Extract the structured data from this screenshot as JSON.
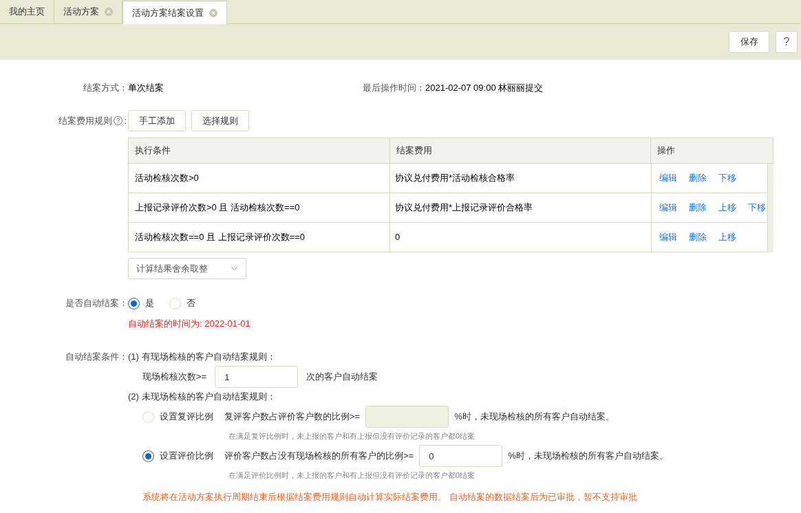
{
  "tabs": [
    {
      "label": "我的主页",
      "selected": false,
      "closable": false
    },
    {
      "label": "活动方案",
      "selected": false,
      "closable": true
    },
    {
      "label": "活动方案结案设置",
      "selected": true,
      "closable": true
    }
  ],
  "toolbar": {
    "save": "保存",
    "help": "?"
  },
  "info": {
    "close_mode_label": "结案方式：",
    "close_mode": "单次结案",
    "last_op_label": "最后操作时间：",
    "last_op": "2021-02-07 09:00 林丽丽提交"
  },
  "fee_rules": {
    "label": "结案费用规则",
    "help_mark": "?",
    "colon": ":",
    "buttons": [
      "手工添加",
      "选择规则"
    ],
    "columns": [
      "执行条件",
      "结案费用",
      "操作"
    ],
    "rows": [
      {
        "condition": "活动检核次数>0",
        "fee": "协议兑付费用*活动检核合格率",
        "actions": [
          "编辑",
          "删除",
          "下移"
        ]
      },
      {
        "condition": "上报记录评价次数>0 且 活动检核次数==0",
        "fee": "协议兑付费用*上报记录评价合格率",
        "actions": [
          "编辑",
          "删除",
          "上移",
          "下移"
        ]
      },
      {
        "condition": "活动检核次数==0 且 上报记录评价次数==0",
        "fee": "0",
        "actions": [
          "编辑",
          "删除",
          "上移"
        ]
      }
    ],
    "rounding": "计算结果舍余取整"
  },
  "auto_close": {
    "label": "是否自动结案：",
    "options": [
      {
        "label": "是",
        "selected": true
      },
      {
        "label": "否",
        "selected": false
      }
    ],
    "note": "自动结案的时间为: 2022-01-01"
  },
  "conditions": {
    "label": "自动结案条件：",
    "rule1": "(1) 有现场检核的客户自动结案规则：",
    "rule1_prefix": "现场检核次数>=",
    "rule1_value": "1",
    "rule1_suffix": "次的客户自动结案",
    "rule2": "(2) 未现场检核的客户自动结案规则：",
    "options": [
      {
        "label": "设置复评比例",
        "selected": false,
        "prefix": "复评客户数占评价客户数的比例>=",
        "disabled": true,
        "suffix": "%时，未现场检核的所有客户自动结案。",
        "hint": "在满足复评比例时，未上报的客户和有上报但没有评价记录的客户都0结案"
      },
      {
        "label": "设置评价比例",
        "selected": true,
        "prefix": "评价客户数占没有现场检核的所有客户的比例>=",
        "value": "0",
        "disabled": false,
        "suffix": "%时，未现场检核的所有客户自动结案。",
        "hint": "在满足评价比例时，未上报的客户和有上报但没有评价记录的客户都0结案"
      }
    ],
    "footer": "系统将在活动方案执行周期结束后根据结案费用规则自动计算实际结案费用。 自动结案的数据结案后为已审批，暂不支持审批"
  }
}
